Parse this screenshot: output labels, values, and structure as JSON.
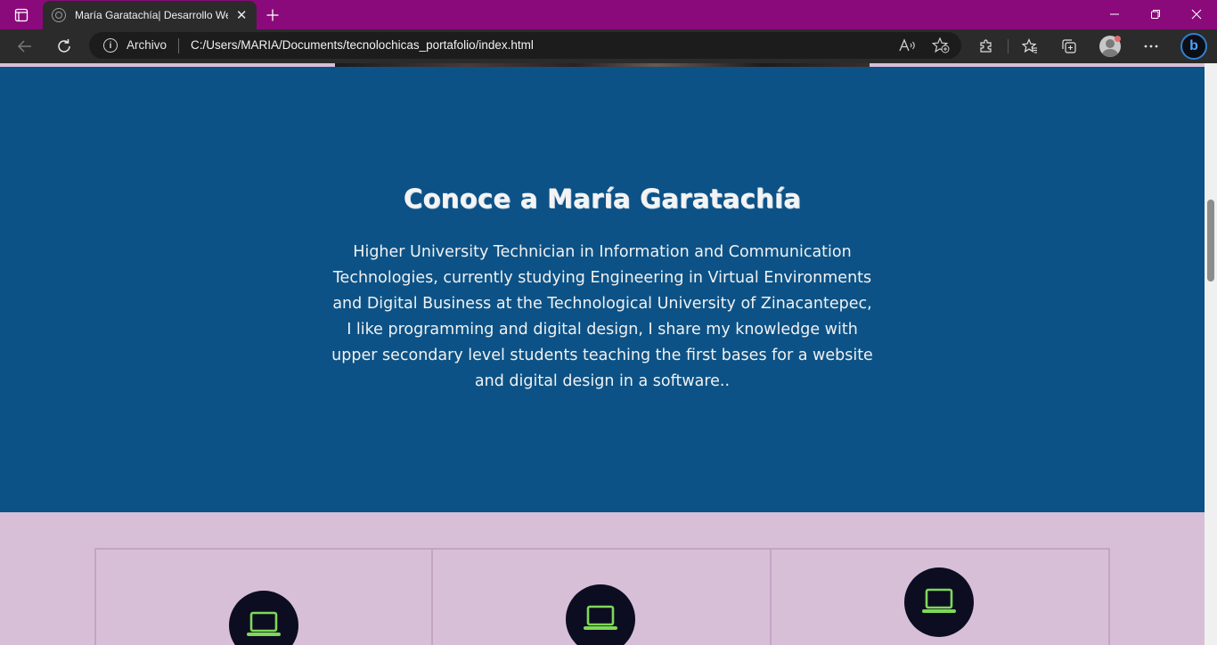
{
  "browser": {
    "tab_title": "María Garatachía| Desarrollo Web",
    "address": {
      "label": "Archivo",
      "url": "C:/Users/MARIA/Documents/tecnolochicas_portafolio/index.html"
    }
  },
  "page": {
    "about": {
      "title": "Conoce a María Garatachía",
      "text": "Higher University Technician in Information and Communication Technologies, currently studying Engineering in Virtual Environments and Digital Business at the Technological University of Zinacantepec, I like programming and digital design, I share my knowledge with upper secondary level students teaching the first bases for a website and digital design in a software..",
      "background": "#0c5286"
    },
    "cards": [
      {
        "icon": "laptop-icon"
      },
      {
        "icon": "laptop-icon"
      },
      {
        "icon": "laptop-icon"
      }
    ],
    "colors": {
      "titlebar": "#8b0a7b",
      "page_background": "#d8bfd8",
      "icon_circle": "#0d0d22",
      "icon_green": "#7ed957"
    }
  }
}
